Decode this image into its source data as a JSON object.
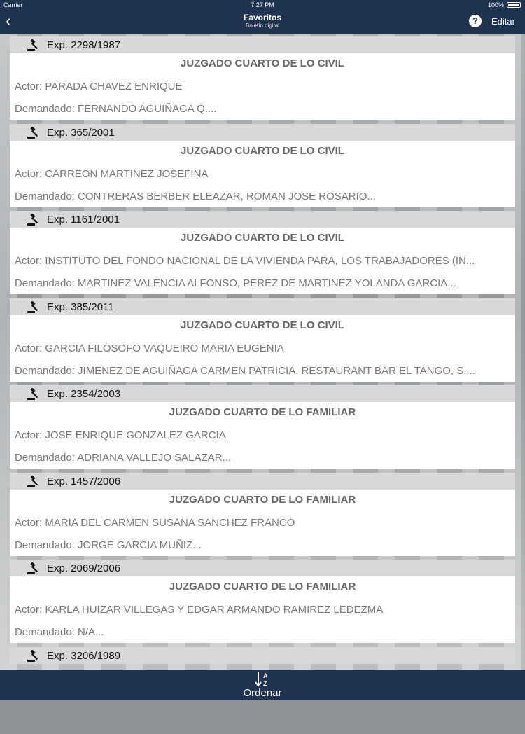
{
  "status_bar": {
    "carrier": "Carrier",
    "time": "7:27 PM",
    "battery": "100%"
  },
  "nav_bar": {
    "back_icon": "chevron-left-icon",
    "title": "Favoritos",
    "subtitle": "Boletín digital",
    "help_label": "?",
    "edit_label": "Editar"
  },
  "records": [
    {
      "exp": "Exp. 2298/1987",
      "court": "JUZGADO CUARTO DE LO CIVIL",
      "actor": "Actor: PARADA CHAVEZ ENRIQUE",
      "demandado": "Demandado: FERNANDO AGUIÑAGA Q...."
    },
    {
      "exp": "Exp. 365/2001",
      "court": "JUZGADO CUARTO DE LO CIVIL",
      "actor": "Actor: CARREON MARTINEZ JOSEFINA",
      "demandado": "Demandado: CONTRERAS BERBER ELEAZAR, ROMAN JOSE ROSARIO..."
    },
    {
      "exp": "Exp. 1161/2001",
      "court": "JUZGADO CUARTO DE LO CIVIL",
      "actor": "Actor: INSTITUTO DEL FONDO NACIONAL DE LA VIVIENDA PARA, LOS TRABAJADORES (IN...",
      "demandado": "Demandado: MARTINEZ VALENCIA ALFONSO, PEREZ DE MARTINEZ YOLANDA GARCIA..."
    },
    {
      "exp": "Exp. 385/2011",
      "court": "JUZGADO CUARTO DE LO CIVIL",
      "actor": "Actor: GARCIA FILOSOFO VAQUEIRO MARIA EUGENIA",
      "demandado": "Demandado: JIMENEZ DE AGUIÑAGA CARMEN PATRICIA, RESTAURANT BAR EL TANGO, S...."
    },
    {
      "exp": "Exp. 2354/2003",
      "court": "JUZGADO CUARTO DE LO FAMILIAR",
      "actor": "Actor: JOSE ENRIQUE GONZALEZ GARCIA",
      "demandado": "Demandado: ADRIANA VALLEJO SALAZAR..."
    },
    {
      "exp": "Exp. 1457/2006",
      "court": "JUZGADO CUARTO DE LO FAMILIAR",
      "actor": "Actor: MARIA DEL CARMEN SUSANA SANCHEZ FRANCO",
      "demandado": "Demandado: JORGE GARCIA MUÑIZ..."
    },
    {
      "exp": "Exp. 2069/2006",
      "court": "JUZGADO CUARTO DE LO FAMILIAR",
      "actor": "Actor: KARLA HUIZAR VILLEGAS Y EDGAR ARMANDO RAMIREZ LEDEZMA",
      "demandado": "Demandado: N/A..."
    },
    {
      "exp": "Exp. 3206/1989",
      "court": "",
      "actor": "",
      "demandado": ""
    }
  ],
  "tab_bar": {
    "sort_icon": "sort-az-icon",
    "sort_label": "Ordenar"
  },
  "colors": {
    "bar_background": "#1f3350",
    "header_row": "#d8d8d8",
    "card": "#ffffff",
    "text_gray": "#777777"
  }
}
